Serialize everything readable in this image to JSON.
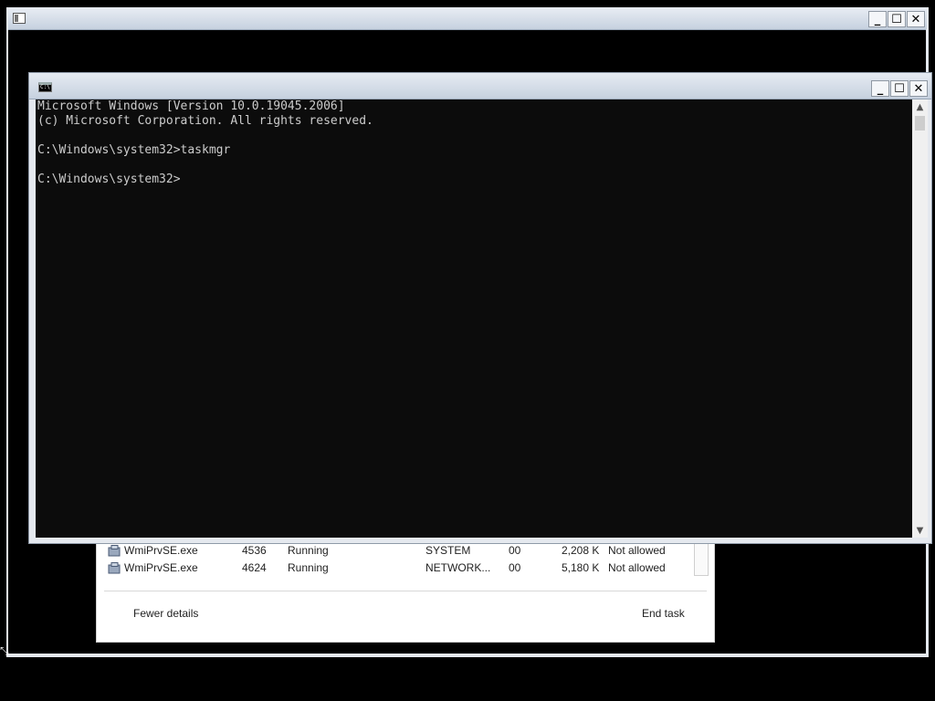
{
  "outer_window": {
    "minimize": "_",
    "maximize": "☐",
    "close": "✕"
  },
  "taskmgr": {
    "rows": [
      {
        "name": "WmiPrvSE.exe",
        "pid": "4536",
        "status": "Running",
        "user": "SYSTEM",
        "cpu": "00",
        "memory": "2,208 K",
        "uac": "Not allowed"
      },
      {
        "name": "WmiPrvSE.exe",
        "pid": "4624",
        "status": "Running",
        "user": "NETWORK...",
        "cpu": "00",
        "memory": "5,180 K",
        "uac": "Not allowed"
      }
    ],
    "fewer_details": "Fewer details",
    "end_task": "End task"
  },
  "cmd_window": {
    "minimize": "_",
    "maximize": "☐",
    "close": "✕",
    "lines": [
      "Microsoft Windows [Version 10.0.19045.2006]",
      "(c) Microsoft Corporation. All rights reserved.",
      "",
      "C:\\Windows\\system32>taskmgr",
      "",
      "C:\\Windows\\system32>"
    ]
  }
}
